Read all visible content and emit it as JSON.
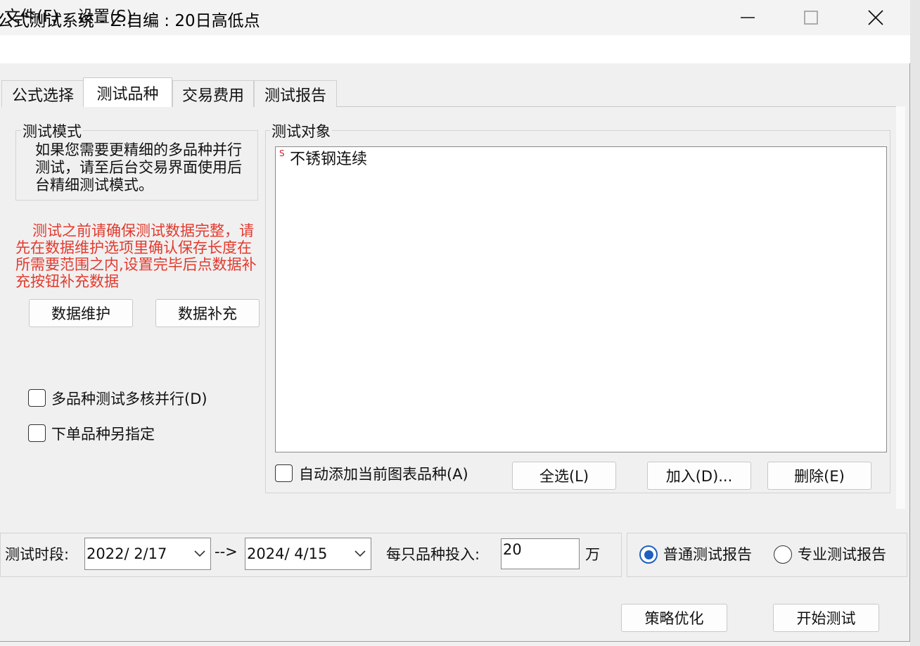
{
  "window": {
    "title": "公式测试系统 - Z.自编 : 20日高低点",
    "controls": {
      "minimize_icon": "minimize-icon",
      "maximize_icon": "maximize-icon",
      "close_icon": "close-icon"
    }
  },
  "menu": {
    "file": "文件(F)",
    "settings": "设置(S)"
  },
  "tabs": [
    {
      "label": "公式选择",
      "active": false
    },
    {
      "label": "测试品种",
      "active": true
    },
    {
      "label": "交易费用",
      "active": false
    },
    {
      "label": "测试报告",
      "active": false
    }
  ],
  "mode": {
    "title": "测试模式",
    "description": "如果您需要更精细的多品种并行测试，请至后台交易界面使用后台精细测试模式。"
  },
  "warning": {
    "text": "测试之前请确保测试数据完整，请先在数据维护选项里确认保存长度在所需要范围之内,设置完毕后点数据补充按钮补充数据",
    "color": "#e23a2e"
  },
  "buttons": {
    "data_maintenance": "数据维护",
    "data_fill": "数据补充",
    "select_all": "全选(L)",
    "add": "加入(D)...",
    "delete": "删除(E)",
    "optimize": "策略优化",
    "start_test": "开始测试"
  },
  "options": {
    "multicore": {
      "label": "多品种测试多核并行(D)",
      "checked": false
    },
    "order_symbol": {
      "label": "下单品种另指定",
      "checked": false
    },
    "auto_add": {
      "label": "自动添加当前图表品种(A)",
      "checked": false
    }
  },
  "target": {
    "title": "测试对象",
    "items": [
      {
        "tag": "S",
        "name": "不锈钢连续"
      }
    ]
  },
  "period": {
    "label": "测试时段:",
    "start": "2022/ 2/17",
    "separator": "-->",
    "end": "2024/ 4/15"
  },
  "investment": {
    "label": "每只品种投入:",
    "value": "20",
    "unit": "万"
  },
  "report": {
    "normal": {
      "label": "普通测试报告",
      "selected": true
    },
    "pro": {
      "label": "专业测试报告",
      "selected": false
    }
  },
  "colors": {
    "accent": "#1f5fbf",
    "warning": "#e23a2e"
  }
}
